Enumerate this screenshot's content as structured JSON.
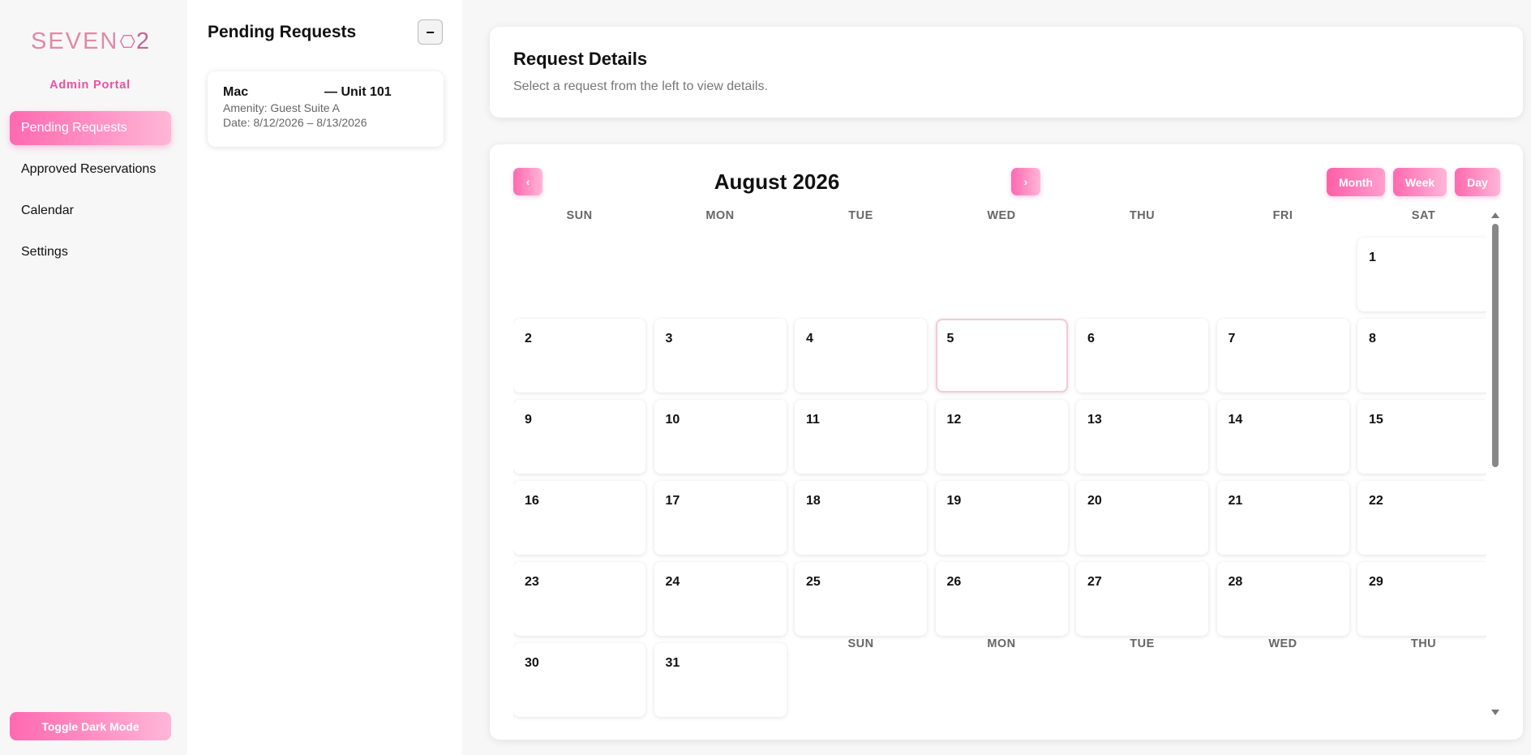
{
  "app": {
    "logo_text": "SEVEN",
    "logo_suffix": "2",
    "portal_label": "Admin Portal"
  },
  "sidebar": {
    "items": [
      {
        "label": "Pending Requests",
        "active": true
      },
      {
        "label": "Approved Reservations",
        "active": false
      },
      {
        "label": "Calendar",
        "active": false
      },
      {
        "label": "Settings",
        "active": false
      }
    ],
    "toggle_label": "Toggle Dark Mode"
  },
  "pending": {
    "title": "Pending Requests",
    "collapse_label": "−",
    "requests": [
      {
        "name": "Mac",
        "unit": "— Unit 101",
        "amenity": "Amenity: Guest Suite A",
        "date": "Date: 8/12/2026 – 8/13/2026"
      }
    ]
  },
  "details": {
    "title": "Request Details",
    "subtitle": "Select a request from the left to view details."
  },
  "calendar": {
    "title": "August 2026",
    "prev_label": "‹",
    "next_label": "›",
    "views": [
      "Month",
      "Week",
      "Day"
    ],
    "active_view": "Month",
    "weekdays": [
      "SUN",
      "MON",
      "TUE",
      "WED",
      "THU",
      "FRI",
      "SAT"
    ],
    "first_weekday_index": 6,
    "days_in_month": 31,
    "today": 5,
    "overflow_weekdays": [
      "SUN",
      "MON",
      "TUE",
      "WED",
      "THU"
    ]
  },
  "colors": {
    "accent": "#ff69b0",
    "accent_light": "#ffb6d7",
    "portal_label": "#ef4fa0",
    "today_border": "#f7c8d8"
  }
}
